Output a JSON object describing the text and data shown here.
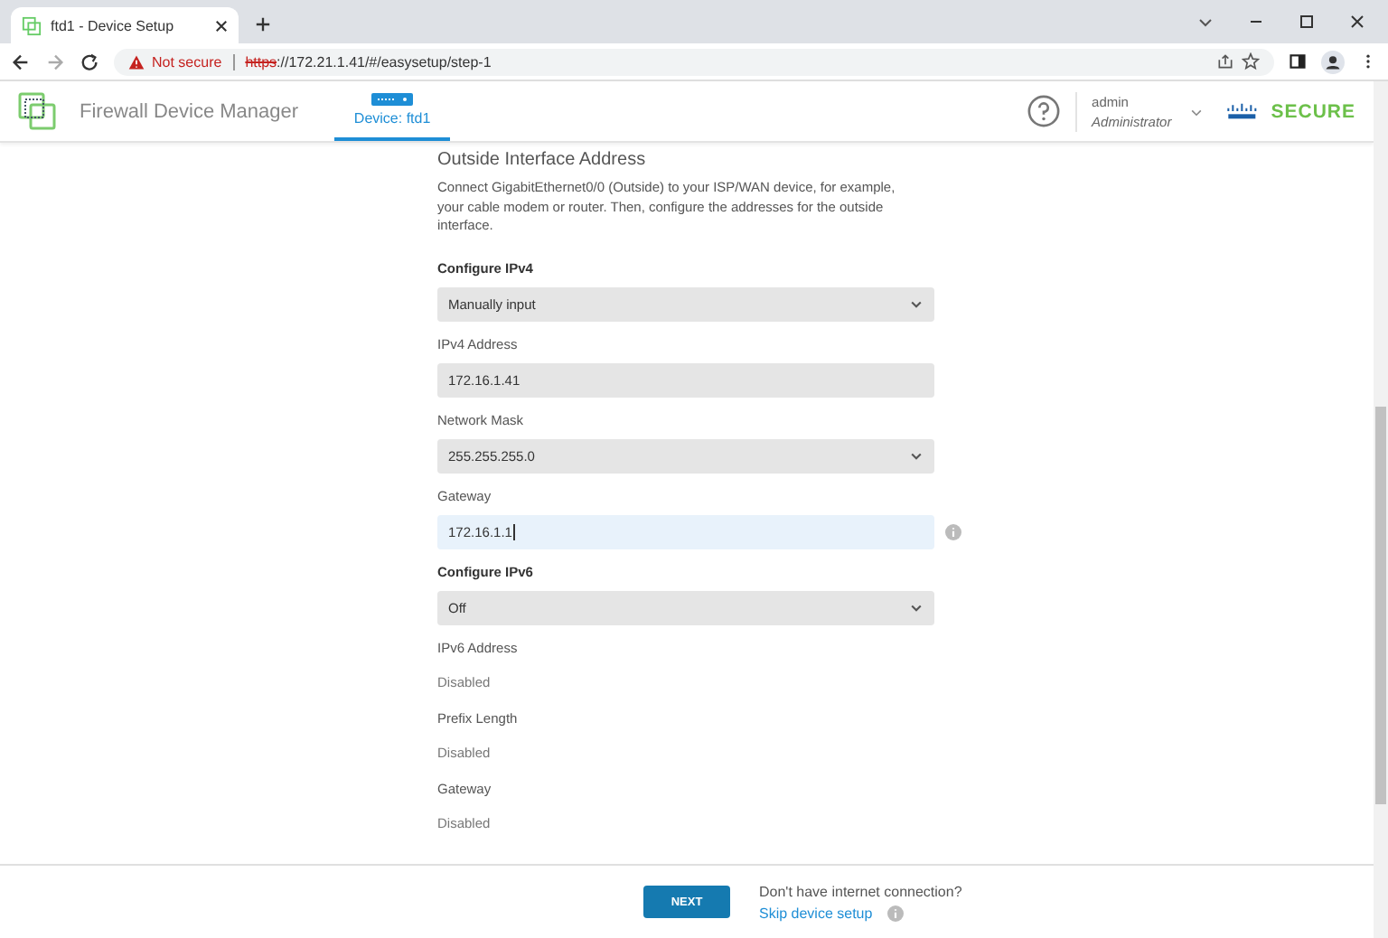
{
  "browser": {
    "tab_title": "ftd1 - Device Setup",
    "security": "Not secure",
    "url_scheme": "https",
    "url_rest": "://172.21.1.41/#/easysetup/step-1"
  },
  "header": {
    "app_name": "Firewall Device Manager",
    "device_tab": "Device: ftd1",
    "user_name": "admin",
    "user_role": "Administrator",
    "brand": "SECURE"
  },
  "section": {
    "title": "Outside Interface Address",
    "description": "Connect GigabitEthernet0/0 (Outside) to your ISP/WAN device, for example, your cable modem or router. Then, configure the addresses for the outside interface."
  },
  "fields": [
    {
      "kind": "select",
      "label": "Configure IPv4",
      "bold": true,
      "value": "Manually input"
    },
    {
      "kind": "input",
      "label": "IPv4 Address",
      "bold": false,
      "value": "172.16.1.41",
      "focused": false,
      "info": false
    },
    {
      "kind": "select",
      "label": "Network Mask",
      "bold": false,
      "value": "255.255.255.0"
    },
    {
      "kind": "input",
      "label": "Gateway",
      "bold": false,
      "value": "172.16.1.1",
      "focused": true,
      "info": true
    },
    {
      "kind": "select",
      "label": "Configure IPv6",
      "bold": true,
      "value": "Off"
    },
    {
      "kind": "static",
      "label": "IPv6 Address",
      "bold": false,
      "value": "Disabled"
    },
    {
      "kind": "static",
      "label": "Prefix Length",
      "bold": false,
      "value": "Disabled"
    },
    {
      "kind": "static",
      "label": "Gateway",
      "bold": false,
      "value": "Disabled"
    }
  ],
  "footer": {
    "next_button": "NEXT",
    "question": "Don't have internet connection?",
    "skip_link": "Skip device setup"
  }
}
